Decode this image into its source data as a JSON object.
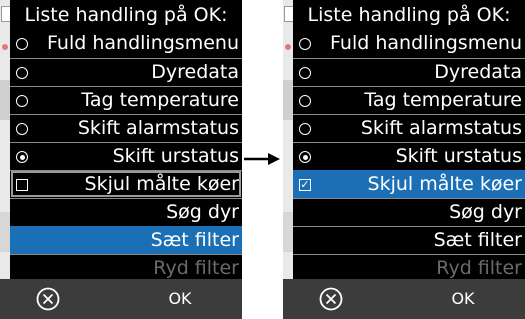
{
  "screens": [
    {
      "title": "Liste handling på OK:",
      "items": [
        {
          "label": "Fuld handlingsmenu",
          "control": "radio",
          "checked": false
        },
        {
          "label": "Dyredata",
          "control": "radio",
          "checked": false
        },
        {
          "label": "Tag temperature",
          "control": "radio",
          "checked": false
        },
        {
          "label": "Skift alarmstatus",
          "control": "radio",
          "checked": false
        },
        {
          "label": "Skift urstatus",
          "control": "radio",
          "checked": true
        },
        {
          "label": "Skjul målte køer",
          "control": "checkbox",
          "checked": false
        },
        {
          "label": "Søg dyr",
          "control": "none"
        },
        {
          "label": "Sæt filter",
          "control": "none",
          "selected": true
        },
        {
          "label": "Ryd filter",
          "control": "none",
          "disabled": true
        }
      ],
      "bottom_bar": {
        "cancel_icon": "cancel-icon",
        "ok_label": "OK"
      }
    },
    {
      "title": "Liste handling på OK:",
      "items": [
        {
          "label": "Fuld handlingsmenu",
          "control": "radio",
          "checked": false
        },
        {
          "label": "Dyredata",
          "control": "radio",
          "checked": false
        },
        {
          "label": "Tag temperature",
          "control": "radio",
          "checked": false
        },
        {
          "label": "Skift alarmstatus",
          "control": "radio",
          "checked": false
        },
        {
          "label": "Skift urstatus",
          "control": "radio",
          "checked": true
        },
        {
          "label": "Skjul målte køer",
          "control": "checkbox",
          "checked": true,
          "selected": true
        },
        {
          "label": "Søg dyr",
          "control": "none"
        },
        {
          "label": "Sæt filter",
          "control": "none"
        },
        {
          "label": "Ryd filter",
          "control": "none",
          "disabled": true
        }
      ],
      "bottom_bar": {
        "cancel_icon": "cancel-icon",
        "ok_label": "OK"
      }
    }
  ],
  "transition_icon": "right-arrow-icon",
  "colors": {
    "selected": "#1b6fb5",
    "background": "#000000",
    "bar": "#3c3c3c",
    "disabled_text": "#6a6a6a"
  }
}
